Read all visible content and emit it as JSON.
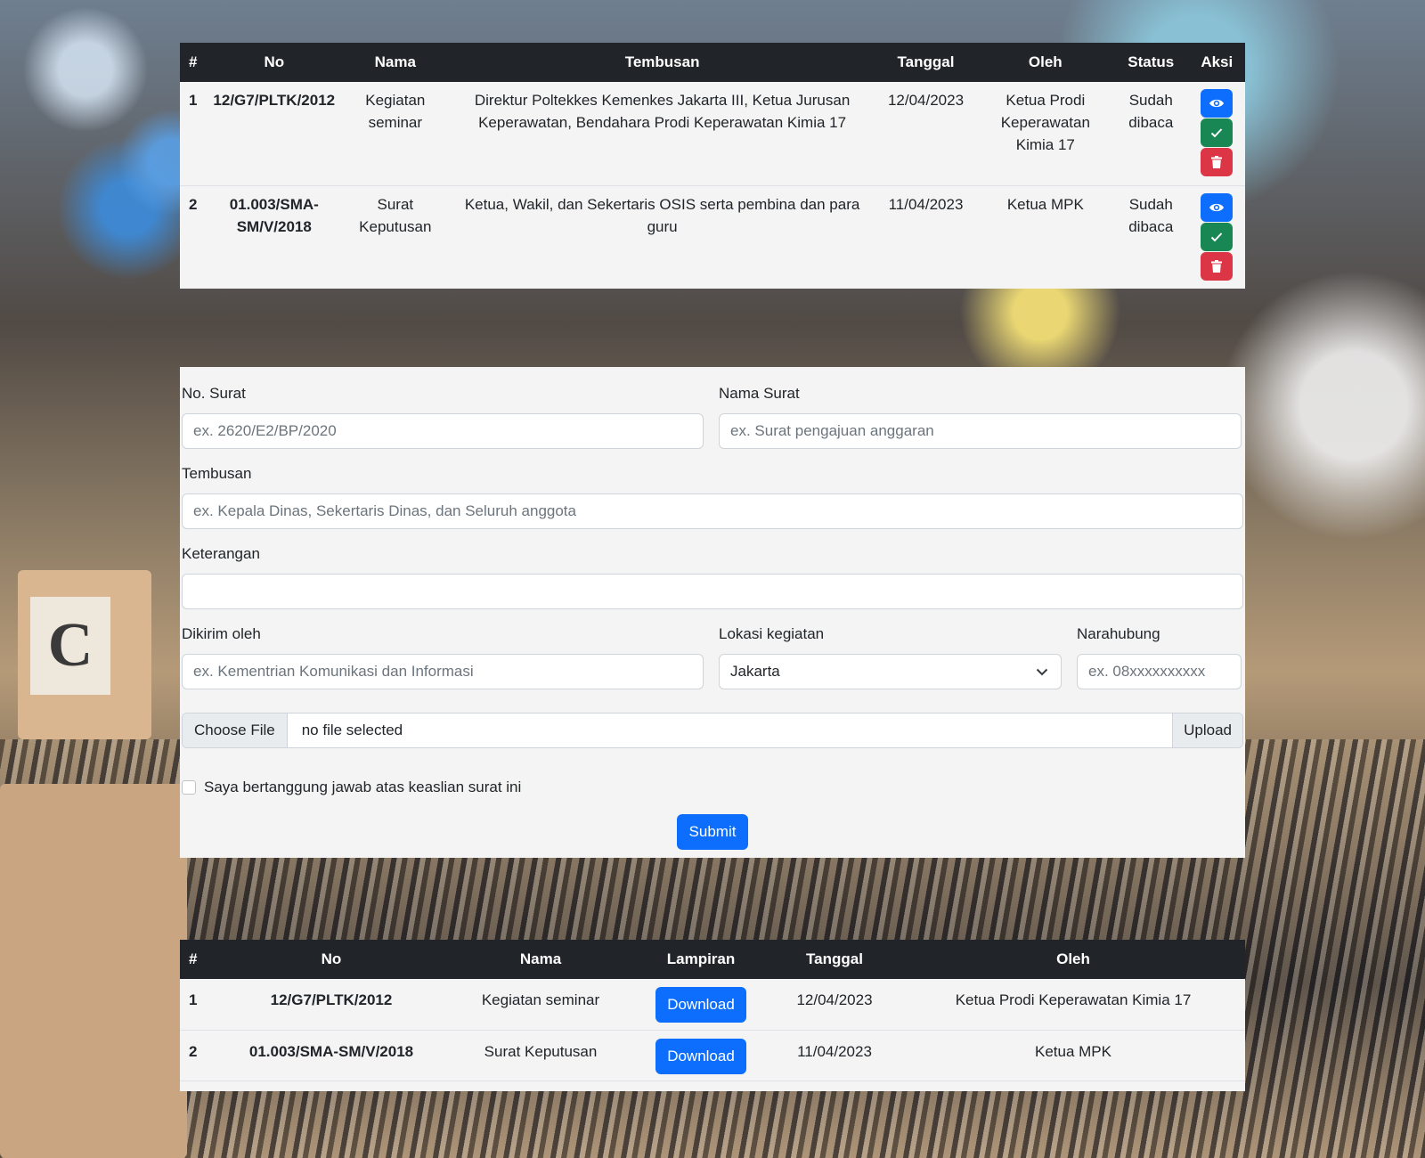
{
  "table1": {
    "headers": [
      "#",
      "No",
      "Nama",
      "Tembusan",
      "Tanggal",
      "Oleh",
      "Status",
      "Aksi"
    ],
    "rows": [
      {
        "idx": "1",
        "no": "12/G7/PLTK/2012",
        "nama": "Kegiatan seminar",
        "tembusan": "Direktur Poltekkes Kemenkes Jakarta III, Ketua Jurusan Keperawatan, Bendahara Prodi Keperawatan Kimia 17",
        "tanggal": "12/04/2023",
        "oleh": "Ketua Prodi Keperawatan Kimia 17",
        "status": "Sudah dibaca"
      },
      {
        "idx": "2",
        "no": "01.003/SMA-SM/V/2018",
        "nama": "Surat Keputusan",
        "tembusan": "Ketua, Wakil, dan Sekertaris OSIS serta pembina dan para guru",
        "tanggal": "11/04/2023",
        "oleh": "Ketua MPK",
        "status": "Sudah dibaca"
      }
    ],
    "action_icons": [
      "eye-icon",
      "check-icon",
      "trash-icon"
    ]
  },
  "form": {
    "no_surat": {
      "label": "No. Surat",
      "placeholder": "ex. 2620/E2/BP/2020"
    },
    "nama_surat": {
      "label": "Nama Surat",
      "placeholder": "ex. Surat pengajuan anggaran"
    },
    "tembusan": {
      "label": "Tembusan",
      "placeholder": "ex. Kepala Dinas, Sekertaris Dinas, dan Seluruh anggota"
    },
    "keterangan": {
      "label": "Keterangan",
      "placeholder": ""
    },
    "dikirim_oleh": {
      "label": "Dikirim oleh",
      "placeholder": "ex. Kementrian Komunikasi dan Informasi"
    },
    "lokasi": {
      "label": "Lokasi kegiatan",
      "value": "Jakarta"
    },
    "narahubung": {
      "label": "Narahubung",
      "placeholder": "ex. 08xxxxxxxxxx"
    },
    "file": {
      "choose_label": "Choose File",
      "filename": "no file selected",
      "upload_label": "Upload"
    },
    "checkbox_label": "Saya bertanggung jawab atas keaslian surat ini",
    "submit_label": "Submit"
  },
  "table2": {
    "headers": [
      "#",
      "No",
      "Nama",
      "Lampiran",
      "Tanggal",
      "Oleh"
    ],
    "rows": [
      {
        "idx": "1",
        "no": "12/G7/PLTK/2012",
        "nama": "Kegiatan seminar",
        "lampiran": "Download",
        "tanggal": "12/04/2023",
        "oleh": "Ketua Prodi Keperawatan Kimia 17"
      },
      {
        "idx": "2",
        "no": "01.003/SMA-SM/V/2018",
        "nama": "Surat Keputusan",
        "lampiran": "Download",
        "tanggal": "11/04/2023",
        "oleh": "Ketua MPK"
      }
    ]
  },
  "colors": {
    "primary": "#0d6efd",
    "success": "#198754",
    "danger": "#dc3545",
    "header_dark": "#212529"
  }
}
